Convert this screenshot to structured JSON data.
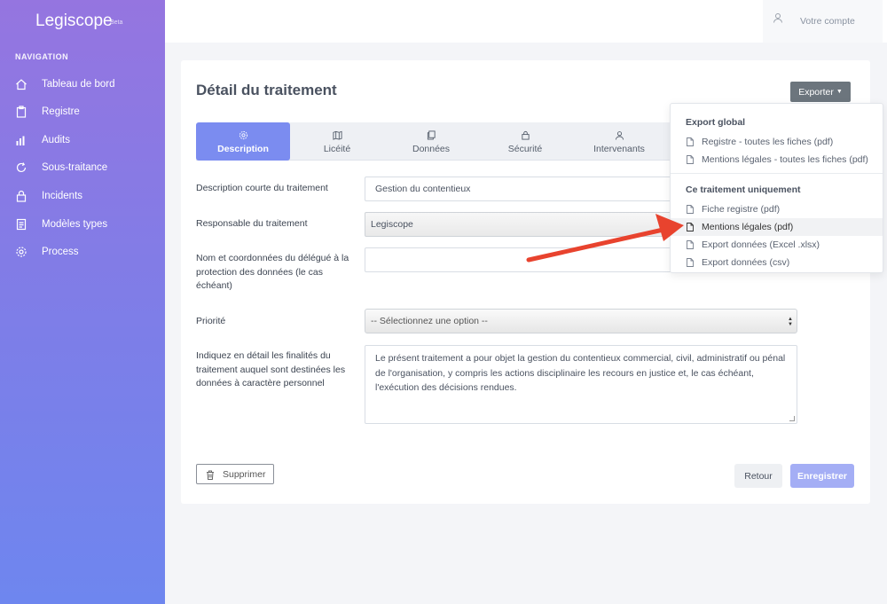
{
  "app": {
    "name": "Legiscope",
    "badge": "Beta"
  },
  "navigation": {
    "title": "NAVIGATION",
    "items": [
      {
        "label": "Tableau de bord",
        "icon": "home-icon"
      },
      {
        "label": "Registre",
        "icon": "clipboard-icon"
      },
      {
        "label": "Audits",
        "icon": "bar-chart-icon"
      },
      {
        "label": "Sous-traitance",
        "icon": "refresh-icon"
      },
      {
        "label": "Incidents",
        "icon": "lock-icon"
      },
      {
        "label": "Modèles types",
        "icon": "document-icon"
      },
      {
        "label": "Process",
        "icon": "gear-icon"
      }
    ]
  },
  "topbar": {
    "account_label": "Votre compte",
    "account_icon": "user-icon"
  },
  "page": {
    "title": "Détail du traitement",
    "export_label": "Exporter"
  },
  "tabs": [
    {
      "label": "Description",
      "icon": "gear-icon",
      "active": true
    },
    {
      "label": "Licéité",
      "icon": "map-icon",
      "active": false
    },
    {
      "label": "Données",
      "icon": "files-icon",
      "active": false
    },
    {
      "label": "Sécurité",
      "icon": "lock-icon",
      "active": false
    },
    {
      "label": "Intervenants",
      "icon": "user-icon",
      "active": false
    }
  ],
  "form": {
    "description_label": "Description courte du traitement",
    "description_value": "Gestion du contentieux",
    "responsable_label": "Responsable du traitement",
    "responsable_value": "Legiscope",
    "dpo_label": "Nom et coordonnées du délégué à la protection des données (le cas échéant)",
    "dpo_value": "",
    "priority_label": "Priorité",
    "priority_value": "-- Sélectionnez une option --",
    "finalites_label": "Indiquez en détail les finalités du traitement auquel sont destinées les données à caractère personnel",
    "finalites_value": "Le présent traitement a pour objet la gestion du contentieux commercial, civil, administratif ou pénal de l'organisation, y compris les actions disciplinaire les recours en justice et, le cas échéant, l'exécution des décisions rendues."
  },
  "buttons": {
    "delete": "Supprimer",
    "back": "Retour",
    "save": "Enregistrer"
  },
  "export_menu": {
    "global_header": "Export global",
    "global_items": [
      "Registre - toutes les fiches (pdf)",
      "Mentions légales - toutes les fiches (pdf)"
    ],
    "single_header": "Ce traitement uniquement",
    "single_items": [
      "Fiche registre (pdf)",
      "Mentions légales (pdf)",
      "Export données (Excel .xlsx)",
      "Export données (csv)"
    ],
    "highlighted": "Mentions légales (pdf)"
  },
  "colors": {
    "sidebar_top": "#9575e0",
    "sidebar_bottom": "#6e86ef",
    "accent": "#7b8cf0",
    "save_button": "#a4aef5",
    "export_button": "#6c757d",
    "annotation_arrow": "#e8432e"
  }
}
